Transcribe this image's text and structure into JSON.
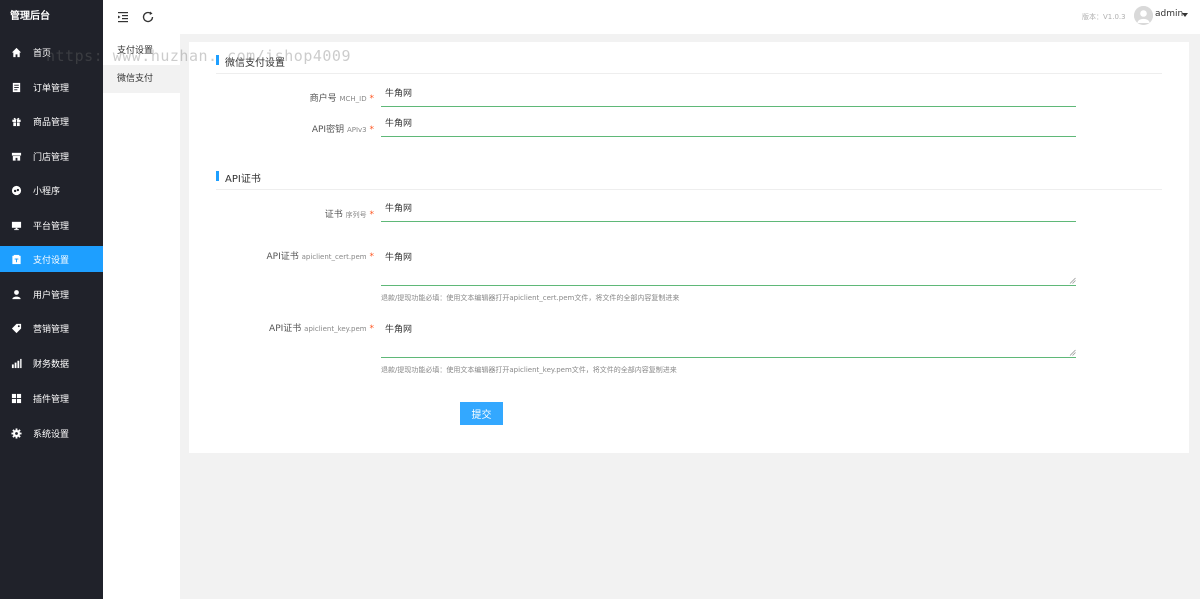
{
  "app": {
    "title": "管理后台"
  },
  "sidebar": {
    "items": [
      {
        "label": "首页",
        "icon": "home-icon"
      },
      {
        "label": "订单管理",
        "icon": "order-icon"
      },
      {
        "label": "商品管理",
        "icon": "gift-icon"
      },
      {
        "label": "门店管理",
        "icon": "store-icon"
      },
      {
        "label": "小程序",
        "icon": "miniprogram-icon"
      },
      {
        "label": "平台管理",
        "icon": "monitor-icon"
      },
      {
        "label": "支付设置",
        "icon": "wallet-icon",
        "active": true
      },
      {
        "label": "用户管理",
        "icon": "user-icon"
      },
      {
        "label": "营销管理",
        "icon": "tag-icon"
      },
      {
        "label": "财务数据",
        "icon": "chart-icon"
      },
      {
        "label": "插件管理",
        "icon": "plugin-icon"
      },
      {
        "label": "系统设置",
        "icon": "gear-icon"
      }
    ]
  },
  "subnav": {
    "items": [
      {
        "label": "支付设置"
      },
      {
        "label": "微信支付",
        "active": true
      }
    ]
  },
  "header": {
    "version": "版本：V1.0.3",
    "user": "admin"
  },
  "watermark": "https: www.huzhan. com/ishop4009",
  "form": {
    "section1_title": "微信支付设置",
    "mch_id": {
      "label": "商户号",
      "sub": "MCH_ID",
      "required": "*",
      "value": "牛角网"
    },
    "api_key": {
      "label": "API密钥",
      "sub": "APIv3",
      "required": "*",
      "value": "牛角网"
    },
    "section2_title": "API证书",
    "serial": {
      "label": "证书",
      "sub": "序列号",
      "required": "*",
      "value": "牛角网"
    },
    "cert": {
      "label": "API证书",
      "sub": "apiclient_cert.pem",
      "required": "*",
      "value": "牛角网",
      "hint": "退款/提现功能必填：使用文本编辑器打开apiclient_cert.pem文件，将文件的全部内容复制进来"
    },
    "key": {
      "label": "API证书",
      "sub": "apiclient_key.pem",
      "required": "*",
      "value": "牛角网",
      "hint": "退款/提现功能必填：使用文本编辑器打开apiclient_key.pem文件，将文件的全部内容复制进来"
    },
    "submit_label": "提交"
  },
  "colors": {
    "sidebar_bg": "#20222a",
    "accent": "#1e9fff",
    "input_underline": "#5fb878",
    "required": "#ff5722"
  }
}
